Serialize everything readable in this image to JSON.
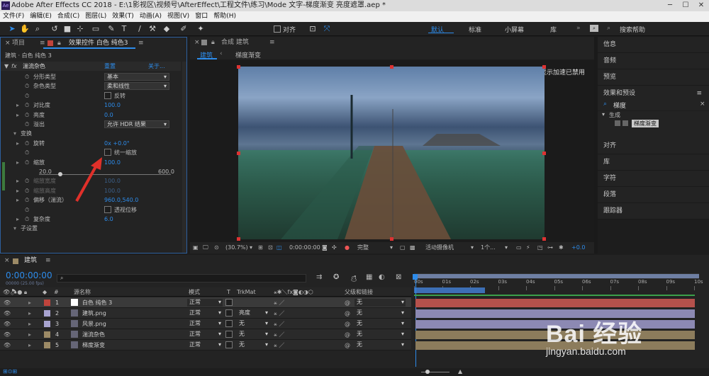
{
  "app": {
    "title": "Adobe After Effects CC 2018 - E:\\1影视区\\视频号\\AfterEffect\\工程文件\\练习\\Mode 文字-梯度渐变 亮度遮罩.aep *",
    "logo": "Ae"
  },
  "menu": [
    "文件(F)",
    "编辑(E)",
    "合成(C)",
    "图层(L)",
    "效果(T)",
    "动画(A)",
    "视图(V)",
    "窗口",
    "帮助(H)"
  ],
  "toolbar": {
    "align_label": "对齐",
    "workspaces": [
      "默认",
      "标准",
      "小屏幕",
      "库"
    ],
    "active_workspace": "默认",
    "search_placeholder": "搜索帮助"
  },
  "left_panel": {
    "tab_project": "项目",
    "tab_effects": "效果控件 白色 纯色3",
    "breadcrumb": "建筑 · 白色 纯色 3",
    "effect_name": "湍流杂色",
    "reset": "重置",
    "about": "关于...",
    "props": [
      {
        "label": "分形类型",
        "value": "基本",
        "kind": "dd"
      },
      {
        "label": "杂色类型",
        "value": "柔和线性",
        "kind": "dd"
      },
      {
        "label": "",
        "value": "反转",
        "kind": "cb"
      },
      {
        "label": "对比度",
        "value": "100.0",
        "kind": "num"
      },
      {
        "label": "亮度",
        "value": "0.0",
        "kind": "num"
      },
      {
        "label": "溢出",
        "value": "允许 HDR 结果",
        "kind": "dd"
      },
      {
        "label": "变换",
        "value": "",
        "kind": "group"
      },
      {
        "label": "旋转",
        "value": "0x +0.0°",
        "kind": "num"
      },
      {
        "label": "",
        "value": "统一缩放",
        "kind": "cb"
      },
      {
        "label": "缩放",
        "value": "100.0",
        "kind": "num"
      },
      {
        "label": "20.0",
        "value": "600.0",
        "kind": "slider"
      },
      {
        "label": "缩放宽度",
        "value": "100.0",
        "kind": "dim"
      },
      {
        "label": "缩放高度",
        "value": "100.0",
        "kind": "dim"
      },
      {
        "label": "偏移（湍流）",
        "value": "960.0,540.0",
        "kind": "num"
      },
      {
        "label": "",
        "value": "透视位移",
        "kind": "cb"
      },
      {
        "label": "复杂度",
        "value": "6.0",
        "kind": "num"
      },
      {
        "label": "子设置",
        "value": "",
        "kind": "group"
      }
    ]
  },
  "comp_panel": {
    "title": "合成 建筑",
    "tab_active": "建筑",
    "tab_other": "梯度渐变",
    "accel_notice": "显示加速已禁用",
    "zoom": "(30.7%)",
    "timecode": "0:00:00:00",
    "quality": "完整",
    "camera": "活动摄像机",
    "views": "1个...",
    "exposure": "+0.0"
  },
  "right_panel": {
    "items": [
      "信息",
      "音频",
      "预览",
      "效果和预设"
    ],
    "search_value": "梯度",
    "tree_group": "生成",
    "tree_item": "梯度渐变",
    "items2": [
      "对齐",
      "库",
      "字符",
      "段落",
      "跟踪器"
    ]
  },
  "timeline": {
    "comp_tab": "建筑",
    "timecode": "0:00:00:00",
    "fps": "00000 (25.00 fps)",
    "headers": {
      "source": "源名称",
      "mode": "模式",
      "t": "T",
      "trkmat": "TrkMat",
      "parent": "父级和链接"
    },
    "ruler": [
      "00s",
      "01s",
      "02s",
      "03s",
      "04s",
      "05s",
      "06s",
      "07s",
      "08s",
      "09s",
      "10s"
    ],
    "layers": [
      {
        "num": "1",
        "name": "白色 纯色 3",
        "mode": "正常",
        "trkmat": "",
        "parent": "无",
        "color": "#c0443c",
        "bar": "#b5514c"
      },
      {
        "num": "2",
        "name": "建筑.png",
        "mode": "正常",
        "trkmat": "亮度",
        "parent": "无",
        "color": "#a7a3cf",
        "bar": "#8c89b3"
      },
      {
        "num": "3",
        "name": "风景.png",
        "mode": "正常",
        "trkmat": "无",
        "parent": "无",
        "color": "#a7a3cf",
        "bar": "#8c89b3"
      },
      {
        "num": "4",
        "name": "湍流杂色",
        "mode": "正常",
        "trkmat": "无",
        "parent": "无",
        "color": "#9c8a66",
        "bar": "#8c7c5c"
      },
      {
        "num": "5",
        "name": "梯度渐变",
        "mode": "正常",
        "trkmat": "无",
        "parent": "无",
        "color": "#9c8a66",
        "bar": "#8c7c5c"
      }
    ]
  },
  "watermark": {
    "logo": "Bai 经验",
    "url": "jingyan.baidu.com"
  }
}
